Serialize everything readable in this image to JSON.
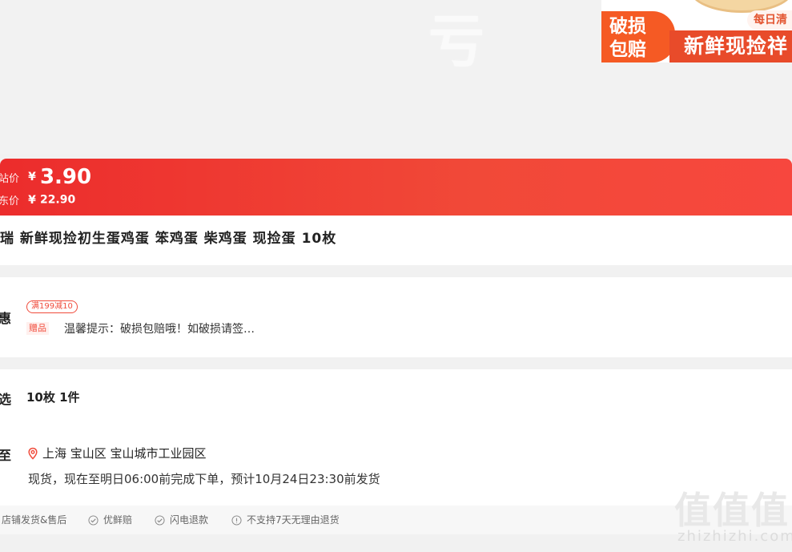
{
  "banner": {
    "badge_line1": "破损",
    "badge_line2": "包赔",
    "daily": "每日清",
    "name": "新鲜现捡祥"
  },
  "price": {
    "current_label": "站价",
    "currency": "¥",
    "current_value": "3.90",
    "original_label": "东价",
    "original_value": "22.90"
  },
  "product": {
    "title": "瑞 新鲜现捡初生蛋鸡蛋 笨鸡蛋 柴鸡蛋 现捡蛋 10枚"
  },
  "promotions": {
    "label": "惠",
    "coupon": "满199减10",
    "gift_tag": "赠品",
    "gift_text": "温馨提示：破损包赔哦！如破损请签…"
  },
  "selection": {
    "label": "选",
    "value": "10枚 1件"
  },
  "delivery": {
    "label": "至",
    "address": "上海 宝山区 宝山城市工业园区",
    "stock": "现货，现在至明日06:00前完成下单，预计10月24日23:30前发货"
  },
  "services": [
    {
      "label": "店铺发货&售后",
      "icon": "none"
    },
    {
      "label": "优鲜赔",
      "icon": "check-circle-icon"
    },
    {
      "label": "闪电退款",
      "icon": "check-circle-icon"
    },
    {
      "label": "不支持7天无理由退货",
      "icon": "info-circle-icon"
    }
  ],
  "watermark": {
    "glyphs": "值值值",
    "url": "zhizhizhi.com"
  },
  "colors": {
    "price_bar": "#f14938",
    "accent": "#f04c3c",
    "banner_orange": "#f55a24"
  }
}
